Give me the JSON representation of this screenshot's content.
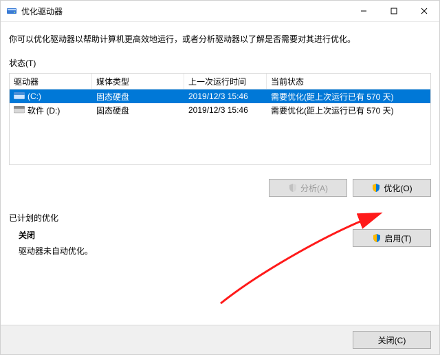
{
  "window": {
    "title": "优化驱动器"
  },
  "description": "你可以优化驱动器以帮助计算机更高效地运行，或者分析驱动器以了解是否需要对其进行优化。",
  "status_label": "状态(T)",
  "columns": {
    "c1": "驱动器",
    "c2": "媒体类型",
    "c3": "上一次运行时间",
    "c4": "当前状态"
  },
  "rows": [
    {
      "name": "(C:)",
      "media": "固态硬盘",
      "last": "2019/12/3 15:46",
      "status": "需要优化(距上次运行已有 570 天)",
      "selected": true
    },
    {
      "name": "软件 (D:)",
      "media": "固态硬盘",
      "last": "2019/12/3 15:46",
      "status": "需要优化(距上次运行已有 570 天)",
      "selected": false
    }
  ],
  "buttons": {
    "analyze": "分析(A)",
    "optimize": "优化(O)",
    "enable": "启用(T)",
    "close": "关闭(C)"
  },
  "plan": {
    "title": "已计划的优化",
    "state": "关闭",
    "note": "驱动器未自动优化。"
  }
}
